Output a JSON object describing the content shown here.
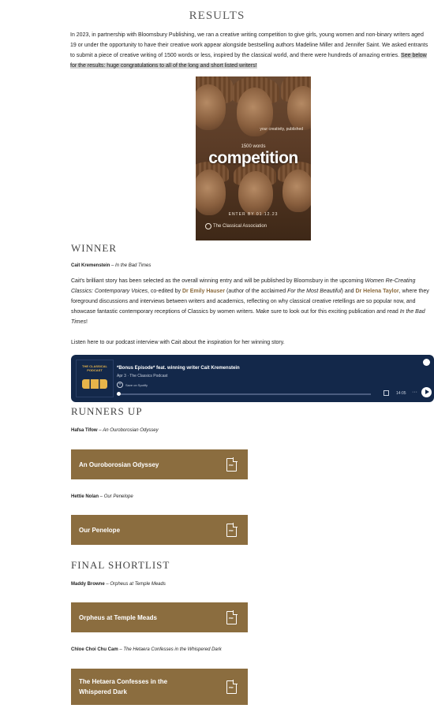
{
  "page": {
    "title": "RESULTS",
    "intro": "In 2023, in partnership with Bloomsbury Publishing, we ran a creative writing competition to give girls, young women and non-binary writers aged 19 or under the opportunity to have their creative work appear alongside bestselling authors Madeline Miller and Jennifer Saint. We asked entrants to submit a piece of creative writing of 1500 words or less, inspired by the classical world, and there were hundreds of amazing entries. ",
    "intro_highlight": "See below for the results: huge congratulations to all of the long and short listed writers!"
  },
  "poster": {
    "tagline": "your creativity, published",
    "words": "1500 words",
    "headline": "competition",
    "enter": "ENTER BY 01.12.23",
    "org": "The Classical Association"
  },
  "winner": {
    "heading": "WINNER",
    "name": "Cait Kremenstein",
    "dash": " – ",
    "work": "In the Bad Times",
    "para_1": "Cait's brilliant story has been selected as the overall winning entry and will be published by Bloomsbury in the upcoming ",
    "book_title": "Women Re-Creating Classics: Contemporary Voices",
    "para_2": ", co-edited by ",
    "editor_1": "Dr Emily Hauser",
    "para_3": " (author of the acclaimed ",
    "book_2": "For the Most Beautiful",
    "para_4": ") and ",
    "editor_2": "Dr Helena Taylor",
    "para_5": ", where they foreground discussions and interviews between writers and academics, reflecting on why classical creative retellings are so popular now, and showcase fantastic contemporary receptions of Classics by women writers. Make sure to look out for this exciting publication and read ",
    "work_again": "In the Bad Times",
    "para_6": "!",
    "podcast_intro": "Listen here to our podcast interview with Cait about the inspiration for her winning story."
  },
  "podcast": {
    "cover_text": "THE CLASSICAL PODCAST",
    "episode_title": "*Bonus Episode* feat. winning writer Cait Kremenstein",
    "meta": "Apr 3 · The Classics Podcast",
    "save_label": "Save on Spotify",
    "duration": "14:05",
    "more": "···",
    "progress": 0
  },
  "runners_up": {
    "heading": "RUNNERS UP",
    "entries": [
      {
        "author": "Hafsa Tifow",
        "work": "An Ouroborosian Odyssey",
        "button": "An Ouroborosian Odyssey"
      },
      {
        "author": "Hettie Nolan",
        "work": "Our Penelope",
        "button": "Our Penelope"
      }
    ]
  },
  "shortlist": {
    "heading": "FINAL SHORTLIST",
    "entries": [
      {
        "author": "Maddy Browne",
        "work": "Orpheus at Temple Meads",
        "button": "Orpheus at Temple Meads"
      },
      {
        "author": "Chloe Choi Chu Cam",
        "work": "The Hetaera Confesses in the Whispered Dark",
        "button": "The Hetaera Confesses in the Whispered Dark"
      }
    ]
  },
  "common": {
    "dash": " – ",
    "pdf_icon": "pdf-file-icon",
    "pdf_text": "PDF"
  },
  "colors": {
    "button_bg": "#8b6d3f",
    "link": "#8a6a3d",
    "podcast_bg": "#13284a"
  }
}
